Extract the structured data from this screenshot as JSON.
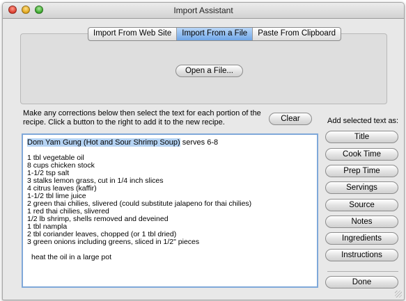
{
  "window": {
    "title": "Import Assistant"
  },
  "tabs": [
    {
      "label": "Import From Web Site",
      "active": false
    },
    {
      "label": "Import From a File",
      "active": true
    },
    {
      "label": "Paste From Clipboard",
      "active": false
    }
  ],
  "open_file_button": "Open a File...",
  "instructions": "Make any corrections below then select the text for each portion of the recipe. Click a button to the right to add it to the new recipe.",
  "clear_button": "Clear",
  "add_selected_label": "Add selected text as:",
  "recipe_text": {
    "selected": "Dom Yam Gung (Hot and Sour Shrimp Soup)",
    "after_selected": " serves 6-8",
    "lines": [
      "1 tbl vegetable oil",
      "8 cups chicken stock",
      "1-1/2 tsp salt",
      "3 stalks lemon grass, cut in 1/4 inch slices",
      "4 citrus leaves (kaffir)",
      "1-1/2 tbl lime juice",
      "2 green thai chilies, slivered (could substitute jalapeno for thai chilies)",
      "1 red thai chilies, slivered",
      "1/2 lb shrimp, shells removed and deveined",
      "1 tbl nampla",
      "2 tbl coriander leaves, chopped (or 1 tbl dried)",
      "3 green onions including greens, sliced in 1/2\" pieces"
    ],
    "last_line": "heat the oil in a large pot"
  },
  "field_buttons": [
    "Title",
    "Cook Time",
    "Prep Time",
    "Servings",
    "Source",
    "Notes",
    "Ingredients",
    "Instructions"
  ],
  "done_button": "Done",
  "colors": {
    "selection": "#b5d3f3",
    "active_tab": "#6fa6e8",
    "focus_ring": "#7fa8d9"
  }
}
